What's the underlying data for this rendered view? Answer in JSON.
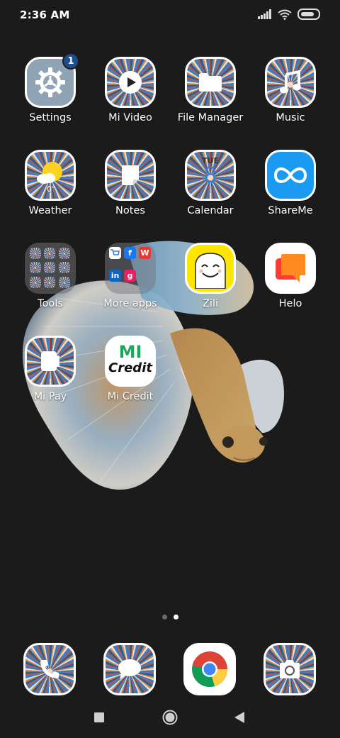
{
  "status_bar": {
    "time": "2:36 AM",
    "icons": [
      "signal-icon",
      "wifi-icon",
      "battery-icon"
    ]
  },
  "apps": [
    {
      "label": "Settings",
      "icon": "gear-icon",
      "badge": "1"
    },
    {
      "label": "Mi Video",
      "icon": "play-icon"
    },
    {
      "label": "File Manager",
      "icon": "folder-icon"
    },
    {
      "label": "Music",
      "icon": "music-note-icon"
    },
    {
      "label": "Weather",
      "icon": "weather-icon",
      "temp": "0°"
    },
    {
      "label": "Notes",
      "icon": "note-icon"
    },
    {
      "label": "Calendar",
      "icon": "calendar-icon",
      "day": "TUE",
      "date": "8"
    },
    {
      "label": "ShareMe",
      "icon": "infinity-icon"
    },
    {
      "label": "Tools",
      "icon": "folder-tools-icon"
    },
    {
      "label": "More apps",
      "icon": "folder-more-apps-icon"
    },
    {
      "label": "Zili",
      "icon": "zili-face-icon"
    },
    {
      "label": "Helo",
      "icon": "helo-chat-icon"
    },
    {
      "label": "Mi Pay",
      "icon": "card-icon"
    },
    {
      "label": "Mi Credit",
      "icon": "mi-credit-logo",
      "logo_line1": "MI",
      "logo_line2": "Credit"
    }
  ],
  "page_indicator": {
    "pages": 2,
    "current": 2
  },
  "dock": [
    {
      "icon": "phone-icon"
    },
    {
      "icon": "message-icon"
    },
    {
      "icon": "chrome-icon"
    },
    {
      "icon": "camera-icon"
    }
  ],
  "nav_bar": [
    "recents-square-icon",
    "home-circle-icon",
    "back-triangle-icon"
  ],
  "colors": {
    "background": "#1b1b1b",
    "badge": "#1c4f8c",
    "shareme": "#1a9af0",
    "zili": "#ffe600",
    "helo": "#ff6a21",
    "mi_credit": "#1aa85a"
  }
}
